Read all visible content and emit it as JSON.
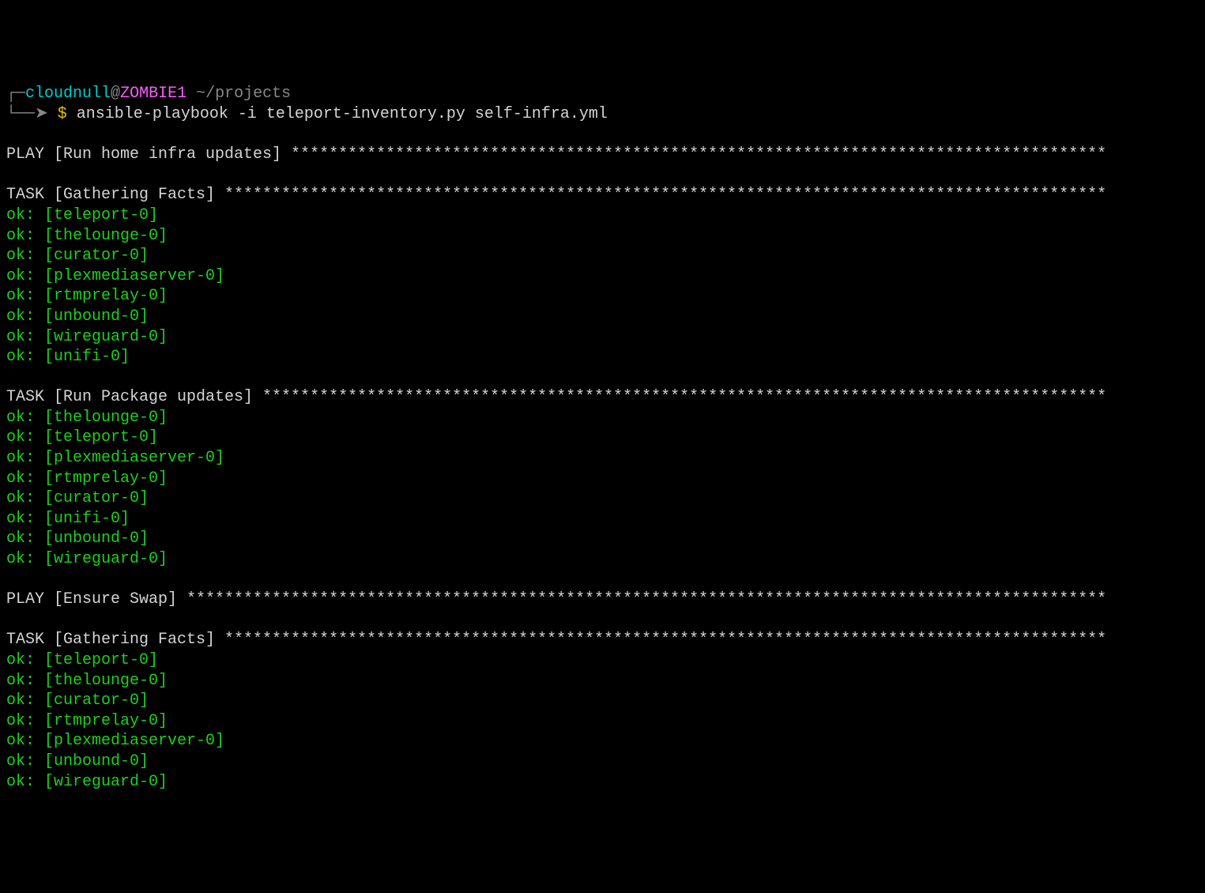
{
  "prompt": {
    "corner_top": "┌─",
    "user": "cloudnull",
    "at": "@",
    "host": "ZOMBIE1",
    "path": "~/projects",
    "corner_bot": "└──➤",
    "dollar": "$",
    "command": "ansible-playbook -i teleport-inventory.py self-infra.yml"
  },
  "sections": [
    {
      "type": "play",
      "label": "PLAY",
      "name": "Run home infra updates"
    },
    {
      "type": "task",
      "label": "TASK",
      "name": "Gathering Facts",
      "ok": [
        "teleport-0",
        "thelounge-0",
        "curator-0",
        "plexmediaserver-0",
        "rtmprelay-0",
        "unbound-0",
        "wireguard-0",
        "unifi-0"
      ]
    },
    {
      "type": "task",
      "label": "TASK",
      "name": "Run Package updates",
      "ok": [
        "thelounge-0",
        "teleport-0",
        "plexmediaserver-0",
        "rtmprelay-0",
        "curator-0",
        "unifi-0",
        "unbound-0",
        "wireguard-0"
      ]
    },
    {
      "type": "play",
      "label": "PLAY",
      "name": "Ensure Swap"
    },
    {
      "type": "task",
      "label": "TASK",
      "name": "Gathering Facts",
      "ok": [
        "teleport-0",
        "thelounge-0",
        "curator-0",
        "rtmprelay-0",
        "plexmediaserver-0",
        "unbound-0",
        "wireguard-0"
      ]
    }
  ],
  "strings": {
    "ok_prefix": "ok: ",
    "bracket_open": "[",
    "bracket_close": "]"
  },
  "term_cols": 116
}
